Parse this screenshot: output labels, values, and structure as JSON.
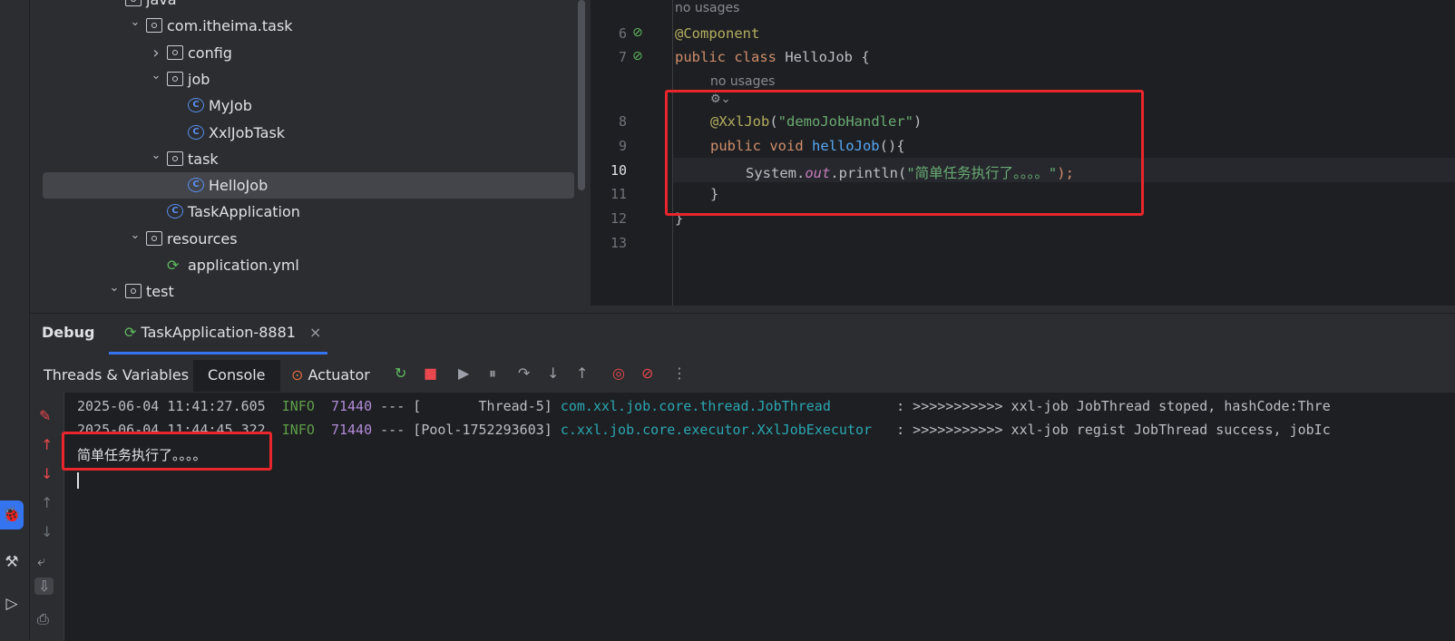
{
  "tree": [
    {
      "label": "java",
      "type": "folder",
      "depth": 0,
      "chev": "v"
    },
    {
      "label": "com.itheima.task",
      "type": "package",
      "depth": 1,
      "chev": "v"
    },
    {
      "label": "config",
      "type": "package",
      "depth": 2,
      "chev": ">"
    },
    {
      "label": "job",
      "type": "package",
      "depth": 2,
      "chev": "v"
    },
    {
      "label": "MyJob",
      "type": "class",
      "depth": 3,
      "chev": ""
    },
    {
      "label": "XxlJobTask",
      "type": "class",
      "depth": 3,
      "chev": ""
    },
    {
      "label": "task",
      "type": "package",
      "depth": 2,
      "chev": "v"
    },
    {
      "label": "HelloJob",
      "type": "class",
      "depth": 3,
      "chev": "",
      "selected": true
    },
    {
      "label": "TaskApplication",
      "type": "app",
      "depth": 2,
      "chev": ""
    },
    {
      "label": "resources",
      "type": "folder",
      "depth": 1,
      "chev": "v"
    },
    {
      "label": "application.yml",
      "type": "yml",
      "depth": 2,
      "chev": ""
    },
    {
      "label": "test",
      "type": "folder",
      "depth": 0,
      "chev": "v"
    }
  ],
  "editor": {
    "hint_top": "no usages",
    "hint_mid": "no usages",
    "line_numbers": [
      "6",
      "7",
      "8",
      "9",
      "10",
      "11",
      "12",
      "13"
    ],
    "l6": "@Component",
    "l7_kw": "public class ",
    "l7_name": "HelloJob",
    "l7_end": " {",
    "l8_ann": "@XxlJob",
    "l8_open": "(",
    "l8_str": "\"demoJobHandler\"",
    "l8_close": ")",
    "l9_kw": "public void ",
    "l9_fn": "helloJob",
    "l9_end": "(){",
    "l10_a": "System.",
    "l10_b": "out",
    "l10_c": ".println(",
    "l10_str": "\"简单任务执行了。。。。\"",
    "l10_end": ");",
    "l11": "}",
    "l12": "}"
  },
  "debug": {
    "title": "Debug",
    "session_tab": "TaskApplication-8881",
    "close_icon": "×",
    "sub_tabs": [
      "Threads & Variables",
      "Console",
      "Actuator"
    ]
  },
  "console": {
    "lines": [
      {
        "ts": "2025-06-04 11:41:27.605",
        "level": "INFO",
        "pid": "71440",
        "sep": " --- [",
        "thread": "       Thread-5]",
        "cls": "com.xxl.job.core.thread.JobThread",
        "msg": "        : >>>>>>>>>>> xxl-job JobThread stoped, hashCode:Thre"
      },
      {
        "ts": "2025-06-04 11:44:45.322",
        "level": "INFO",
        "pid": "71440",
        "sep": " --- [",
        "thread": "Pool-1752293603]",
        "cls": "c.xxl.job.core.executor.XxlJobExecutor",
        "msg": "   : >>>>>>>>>>> xxl-job regist JobThread success, jobIc"
      }
    ],
    "output": "简单任务执行了。。。。"
  },
  "colors": {
    "accent": "#3574f0",
    "highlight": "#e8262b"
  }
}
